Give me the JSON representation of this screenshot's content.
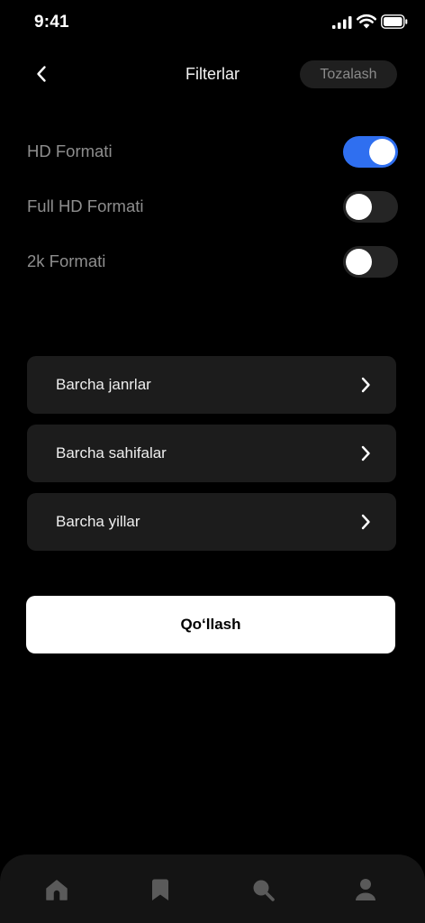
{
  "status_bar": {
    "time": "9:41"
  },
  "nav": {
    "title": "Filterlar",
    "reset_label": "Tozalash"
  },
  "toggles": [
    {
      "label": "HD Formati",
      "on": true
    },
    {
      "label": "Full HD Formati",
      "on": false
    },
    {
      "label": "2k Formati",
      "on": false
    }
  ],
  "list": [
    {
      "label": "Barcha janrlar"
    },
    {
      "label": "Barcha sahifalar"
    },
    {
      "label": "Barcha yillar"
    }
  ],
  "apply_label": "Qo‘llash",
  "tabs": [
    {
      "icon": "home-icon",
      "active": true
    },
    {
      "icon": "bookmark-icon",
      "active": false
    },
    {
      "icon": "search-icon",
      "active": false
    },
    {
      "icon": "profile-icon",
      "active": false
    }
  ],
  "colors": {
    "background": "#000000",
    "accent": "#2f6ff0",
    "card": "#1c1c1c",
    "muted_text": "#8e8e8e",
    "tab_icon": "#5a5a5a"
  }
}
